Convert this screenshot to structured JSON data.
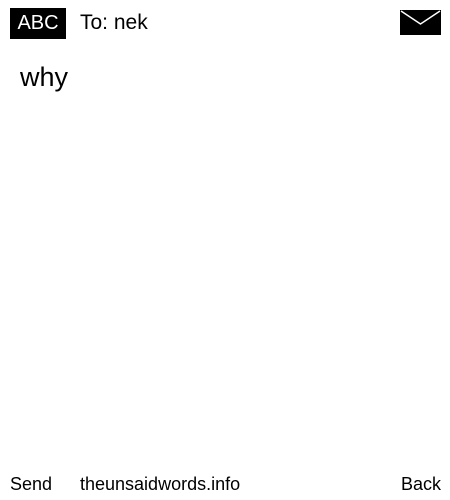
{
  "header": {
    "input_mode": "ABC",
    "recipient": "To: nek",
    "status_icon": "envelope-icon"
  },
  "message": {
    "text": "why"
  },
  "softkeys": {
    "left": "Send",
    "center": "theunsaidwords.info",
    "right": "Back"
  },
  "colors": {
    "background": "#ffffff",
    "foreground": "#000000",
    "badge_background": "#000000",
    "badge_text": "#ffffff"
  }
}
